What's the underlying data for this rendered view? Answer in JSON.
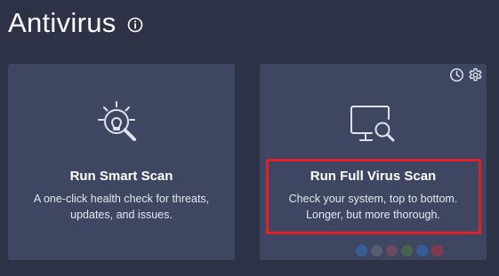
{
  "header": {
    "title": "Antivirus",
    "info_icon": "info-circle-icon"
  },
  "cards": {
    "smart_scan": {
      "icon": "lightbulb-magnifier-icon",
      "title": "Run Smart Scan",
      "description": "A one-click health check for threats, updates, and issues."
    },
    "full_scan": {
      "icon": "monitor-magnifier-icon",
      "title": "Run Full Virus Scan",
      "description": "Check your system, top to bottom. Longer, but more thorough.",
      "tools": [
        "clock-icon",
        "gear-icon"
      ]
    }
  },
  "colors": {
    "background": "#2d3246",
    "card": "#3f4661",
    "highlight": "#e0202a",
    "icon_stroke": "#dfe3ee"
  },
  "watermark_dots": [
    "#2f73c2",
    "#6b6f7e",
    "#8a4f64",
    "#4f7a3e",
    "#2f73c2",
    "#c0313d"
  ]
}
